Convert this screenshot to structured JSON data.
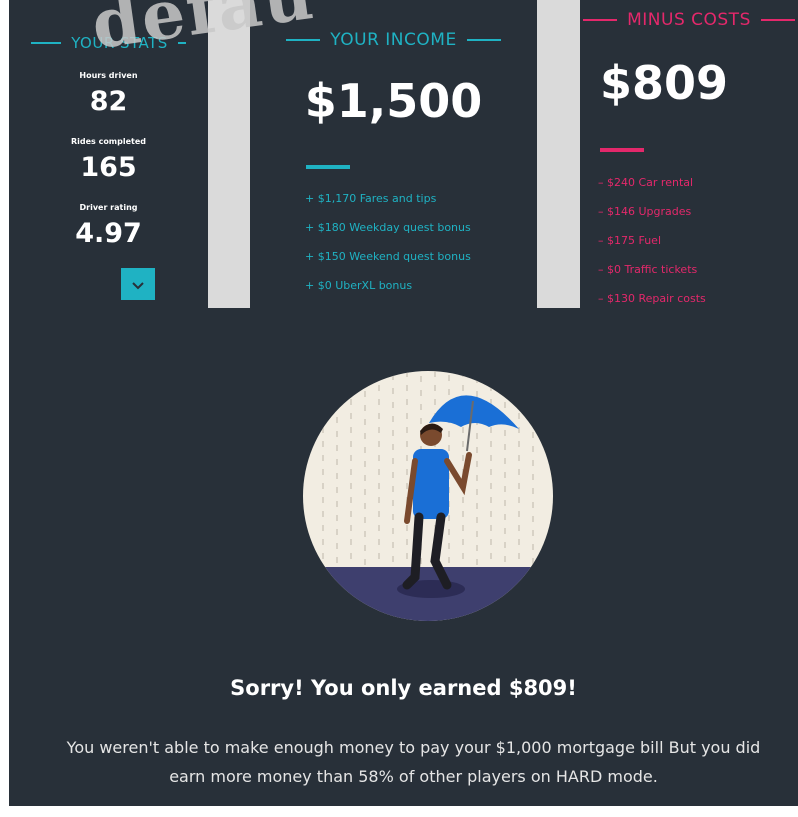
{
  "watermark": "default",
  "stats": {
    "heading": "YOUR STATS",
    "items": [
      {
        "label": "Hours driven",
        "value": "82"
      },
      {
        "label": "Rides completed",
        "value": "165"
      },
      {
        "label": "Driver rating",
        "value": "4.97"
      }
    ],
    "expand_icon": "chevron-down-icon"
  },
  "income": {
    "heading": "YOUR INCOME",
    "total": "$1,500",
    "items": [
      "+ $1,170 Fares and tips",
      "+ $180 Weekday quest bonus",
      "+ $150 Weekend quest bonus",
      "+ $0 UberXL bonus"
    ]
  },
  "costs": {
    "heading": "MINUS COSTS",
    "total": "$809",
    "items": [
      "– $240 Car rental",
      "– $146 Upgrades",
      "– $175 Fuel",
      "– $0 Traffic tickets",
      "– $130 Repair costs"
    ]
  },
  "result": {
    "title": "Sorry! You only earned $809!",
    "message": "You weren't able to make enough money to pay your $1,000 mortgage bill But you did earn more money than 58% of other players on HARD mode."
  },
  "colors": {
    "background": "#283039",
    "income_accent": "#1fb2c3",
    "cost_accent": "#e4286b",
    "umbrella": "#1a6fd6"
  }
}
